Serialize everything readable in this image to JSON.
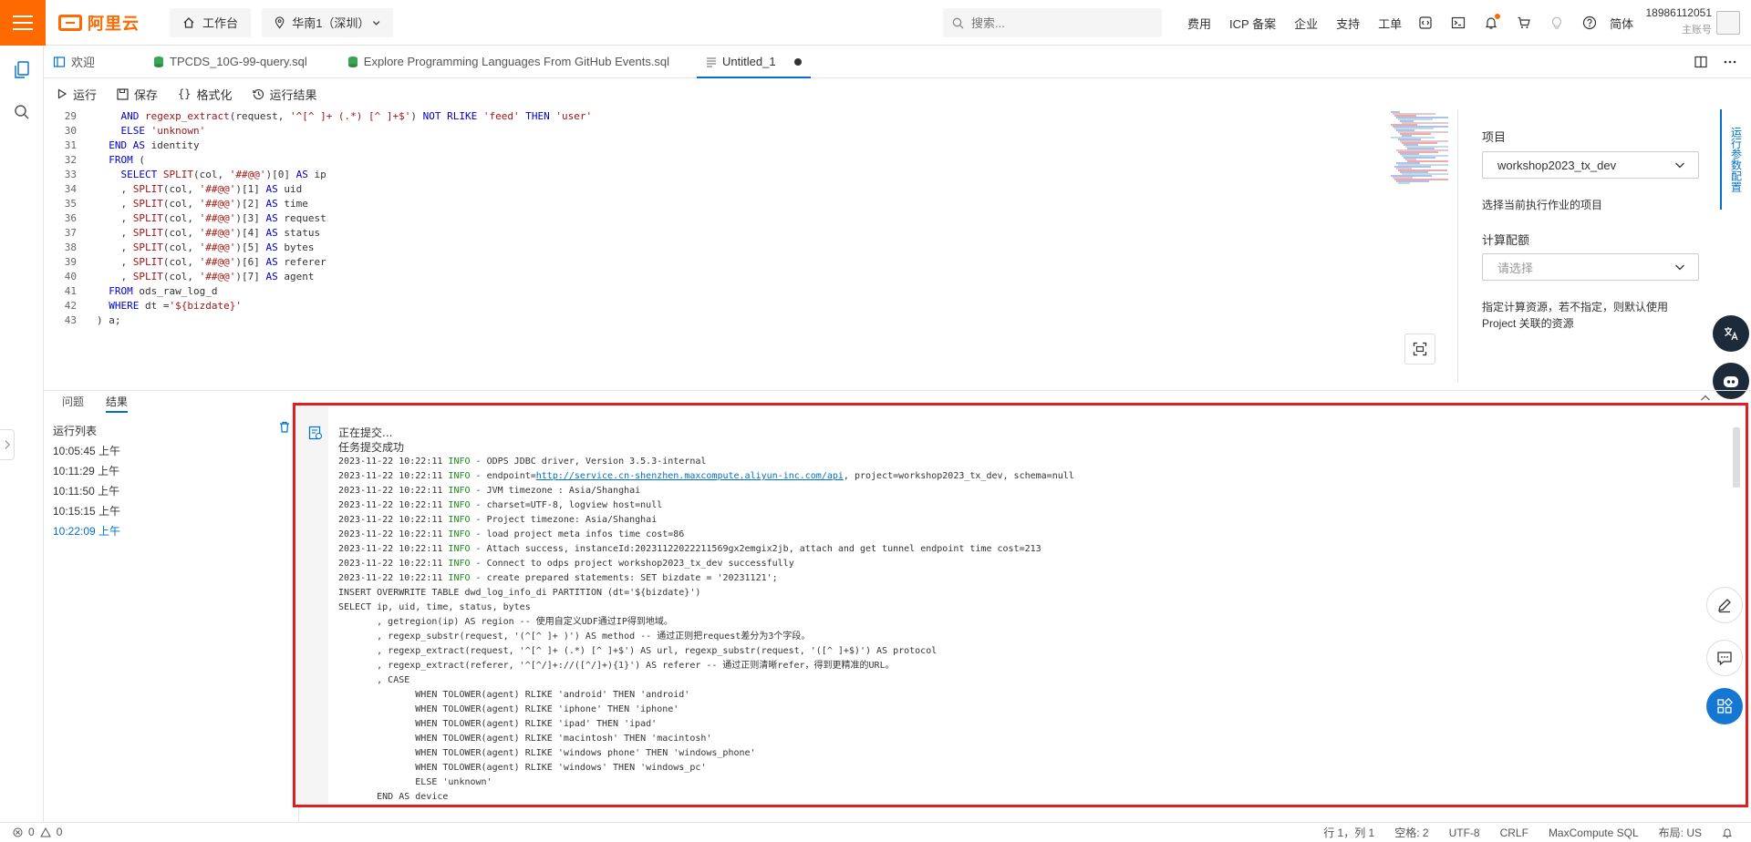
{
  "brand": {
    "logo_text": "阿里云",
    "color": "#ff6a00"
  },
  "topbar": {
    "workbench": "工作台",
    "region": "华南1（深圳）",
    "search_placeholder": "搜索...",
    "links": [
      "费用",
      "ICP 备案",
      "企业",
      "支持",
      "工单"
    ],
    "language": "简体",
    "account_id": "18986112051",
    "account_role": "主账号"
  },
  "tabs": [
    {
      "label": "欢迎",
      "icon": "book-icon"
    },
    {
      "label": "TPCDS_10G-99-query.sql",
      "icon": "sql-file-icon"
    },
    {
      "label": "Explore Programming Languages From GitHub Events.sql",
      "icon": "sql-file-icon"
    },
    {
      "label": "Untitled_1",
      "icon": "doc-icon",
      "active": true,
      "dirty": true
    }
  ],
  "toolbar": {
    "run": "运行",
    "save": "保存",
    "format": "格式化",
    "results": "运行结果"
  },
  "editor": {
    "lines": [
      {
        "n": "29",
        "indent": 4,
        "text": "AND regexp_extract(request, '^[^ ]+ (.*) [^ ]+$') NOT RLIKE 'feed' THEN 'user'"
      },
      {
        "n": "30",
        "indent": 4,
        "text": "ELSE 'unknown'"
      },
      {
        "n": "31",
        "indent": 2,
        "text": "END AS identity"
      },
      {
        "n": "32",
        "indent": 2,
        "text": "FROM ("
      },
      {
        "n": "33",
        "indent": 4,
        "text": "SELECT SPLIT(col, '##@@')[0] AS ip"
      },
      {
        "n": "34",
        "indent": 4,
        "text": ", SPLIT(col, '##@@')[1] AS uid"
      },
      {
        "n": "35",
        "indent": 4,
        "text": ", SPLIT(col, '##@@')[2] AS time"
      },
      {
        "n": "36",
        "indent": 4,
        "text": ", SPLIT(col, '##@@')[3] AS request"
      },
      {
        "n": "37",
        "indent": 4,
        "text": ", SPLIT(col, '##@@')[4] AS status"
      },
      {
        "n": "38",
        "indent": 4,
        "text": ", SPLIT(col, '##@@')[5] AS bytes"
      },
      {
        "n": "39",
        "indent": 4,
        "text": ", SPLIT(col, '##@@')[6] AS referer"
      },
      {
        "n": "40",
        "indent": 4,
        "text": ", SPLIT(col, '##@@')[7] AS agent"
      },
      {
        "n": "41",
        "indent": 2,
        "text": "FROM ods_raw_log_d"
      },
      {
        "n": "42",
        "indent": 2,
        "text": "WHERE dt ='${bizdate}'"
      },
      {
        "n": "43",
        "indent": 0,
        "text": ") a;"
      }
    ]
  },
  "props": {
    "project_label": "项目",
    "project_value": "workshop2023_tx_dev",
    "project_hint": "选择当前执行作业的项目",
    "compute_label": "计算配额",
    "compute_placeholder": "请选择",
    "compute_hint": "指定计算资源，若不指定，则默认使用 Project 关联的资源",
    "vertical_tab": "运行参数配置"
  },
  "bottom": {
    "tabs": [
      "问题",
      "结果"
    ],
    "runlist_title": "运行列表",
    "runs": [
      "10:05:45 上午",
      "10:11:29 上午",
      "10:11:50 上午",
      "10:15:15 上午",
      "10:22:09 上午"
    ]
  },
  "output": {
    "lines": [
      {
        "type": "zh",
        "text": "正在提交..."
      },
      {
        "type": "zh",
        "text": "任务提交成功"
      },
      {
        "type": "log",
        "ts": "2023-11-22 10:22:11",
        "lvl": "INFO",
        "text": " - ODPS JDBC driver, Version 3.5.3-internal"
      },
      {
        "type": "log",
        "ts": "2023-11-22 10:22:11",
        "lvl": "INFO",
        "text": " - endpoint=",
        "url": "http://service.cn-shenzhen.maxcompute.aliyun-inc.com/api",
        "tail": ", project=workshop2023_tx_dev, schema=null"
      },
      {
        "type": "log",
        "ts": "2023-11-22 10:22:11",
        "lvl": "INFO",
        "text": " - JVM timezone : Asia/Shanghai"
      },
      {
        "type": "log",
        "ts": "2023-11-22 10:22:11",
        "lvl": "INFO",
        "text": " - charset=UTF-8, logview host=null"
      },
      {
        "type": "log",
        "ts": "2023-11-22 10:22:11",
        "lvl": "INFO",
        "text": " - Project timezone: Asia/Shanghai"
      },
      {
        "type": "log",
        "ts": "2023-11-22 10:22:11",
        "lvl": "INFO",
        "text": " - load project meta infos time cost=86"
      },
      {
        "type": "log",
        "ts": "2023-11-22 10:22:11",
        "lvl": "INFO",
        "text": " - Attach success, instanceId:20231122022211569gx2emgix2jb, attach and get tunnel endpoint time cost=213"
      },
      {
        "type": "log",
        "ts": "2023-11-22 10:22:11",
        "lvl": "INFO",
        "text": " - Connect to odps project workshop2023_tx_dev successfully"
      },
      {
        "type": "log",
        "ts": "2023-11-22 10:22:11",
        "lvl": "INFO",
        "text": " - create prepared statements: SET bizdate = '20231121';"
      },
      {
        "type": "sql",
        "text": "INSERT OVERWRITE TABLE dwd_log_info_di PARTITION (dt='${bizdate}')"
      },
      {
        "type": "sql",
        "text": "SELECT ip, uid, time, status, bytes"
      },
      {
        "type": "sql",
        "text": "       , getregion(ip) AS region -- 使用自定义UDF通过IP得到地域。"
      },
      {
        "type": "sql",
        "text": "       , regexp_substr(request, '(^[^ ]+ )') AS method -- 通过正则把request差分为3个字段。"
      },
      {
        "type": "sql",
        "text": "       , regexp_extract(request, '^[^ ]+ (.*) [^ ]+$') AS url, regexp_substr(request, '([^ ]+$)') AS protocol"
      },
      {
        "type": "sql",
        "text": "       , regexp_extract(referer, '^[^/]+://([^/]+){1}') AS referer -- 通过正则清晰refer，得到更精准的URL。"
      },
      {
        "type": "sql",
        "text": "       , CASE"
      },
      {
        "type": "sql",
        "text": "              WHEN TOLOWER(agent) RLIKE 'android' THEN 'android'"
      },
      {
        "type": "sql",
        "text": "              WHEN TOLOWER(agent) RLIKE 'iphone' THEN 'iphone'"
      },
      {
        "type": "sql",
        "text": "              WHEN TOLOWER(agent) RLIKE 'ipad' THEN 'ipad'"
      },
      {
        "type": "sql",
        "text": "              WHEN TOLOWER(agent) RLIKE 'macintosh' THEN 'macintosh'"
      },
      {
        "type": "sql",
        "text": "              WHEN TOLOWER(agent) RLIKE 'windows phone' THEN 'windows_phone'"
      },
      {
        "type": "sql",
        "text": "              WHEN TOLOWER(agent) RLIKE 'windows' THEN 'windows_pc'"
      },
      {
        "type": "sql",
        "text": "              ELSE 'unknown'"
      },
      {
        "type": "sql",
        "text": "       END AS device"
      }
    ]
  },
  "statusbar": {
    "errors": "0",
    "warnings": "0",
    "cursor": "行 1，列 1",
    "spaces": "空格: 2",
    "encoding": "UTF-8",
    "eol": "CRLF",
    "language": "MaxCompute SQL",
    "layout": "布局: US"
  }
}
